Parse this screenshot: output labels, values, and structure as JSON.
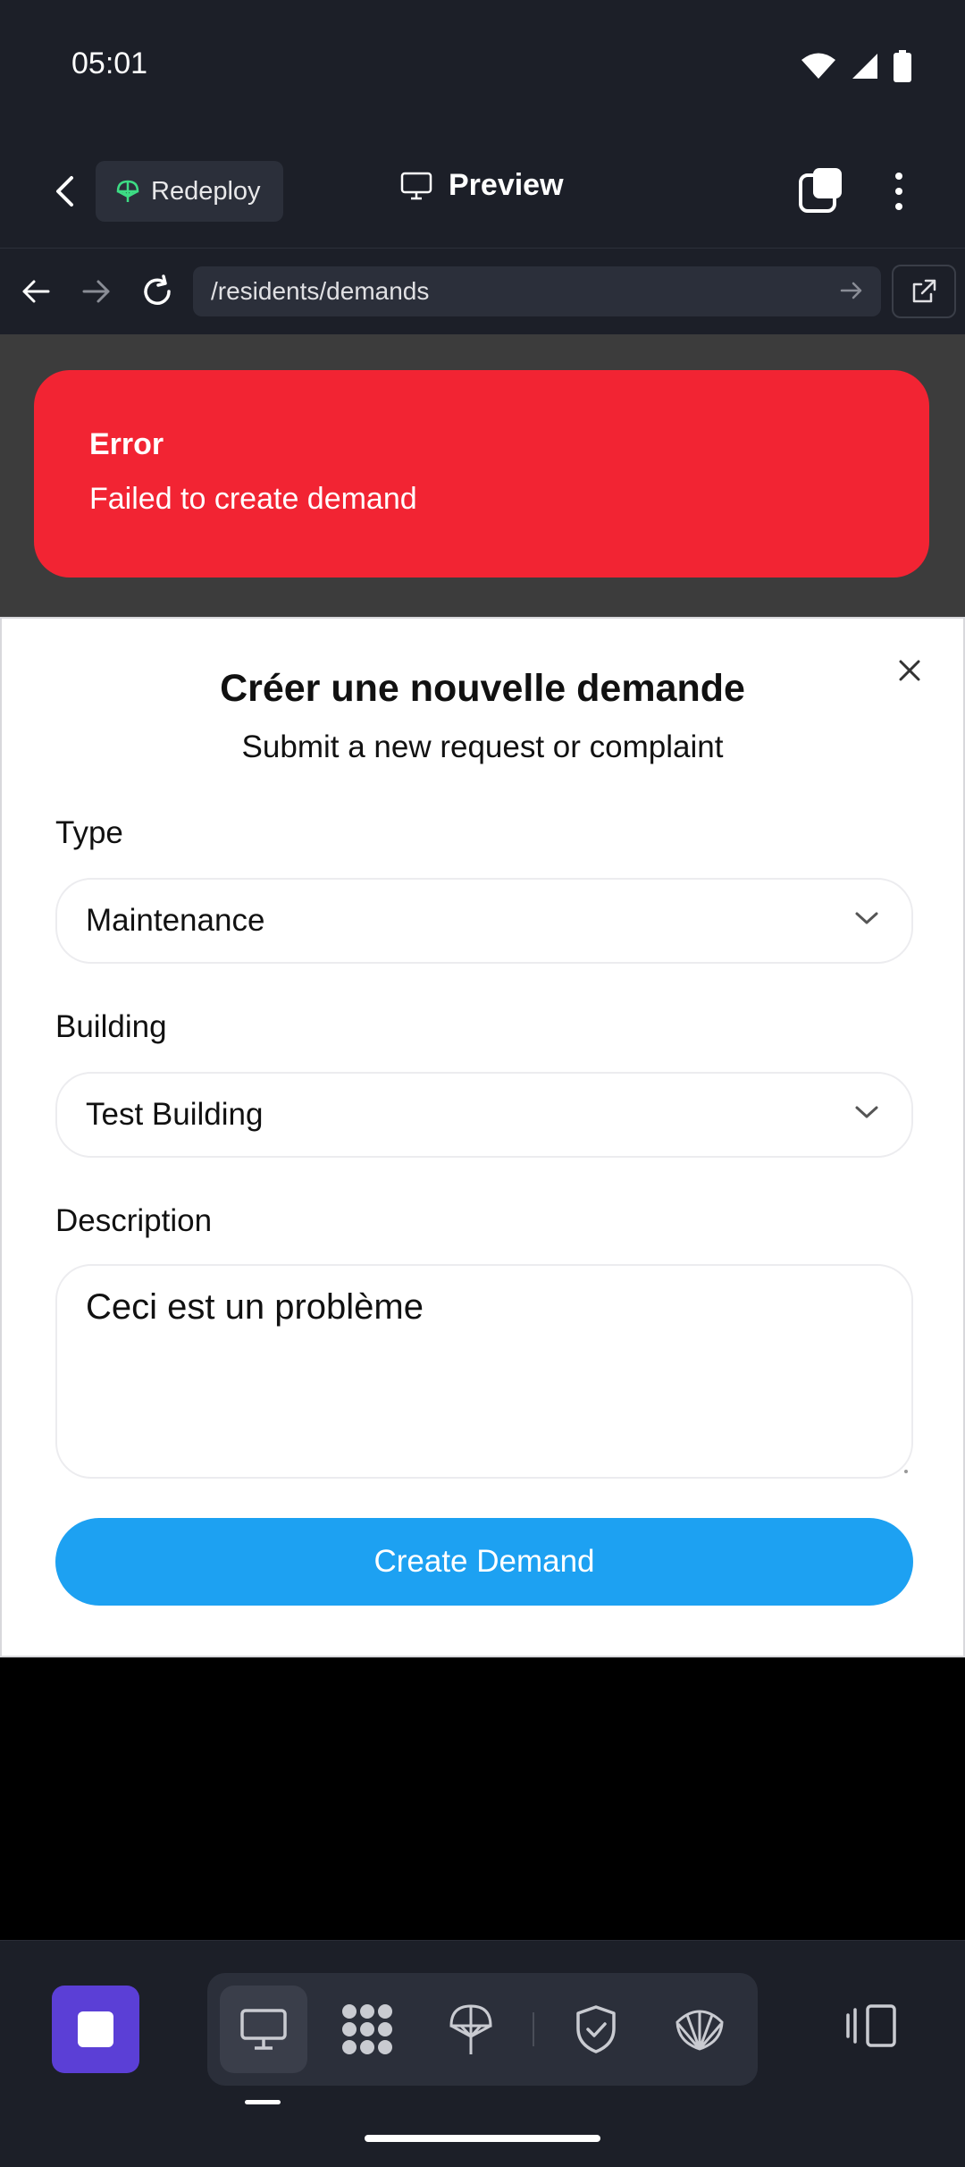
{
  "status_bar": {
    "time": "05:01"
  },
  "header": {
    "redeploy_label": "Redeploy",
    "preview_label": "Preview"
  },
  "browser": {
    "url": "/residents/demands"
  },
  "toast": {
    "title": "Error",
    "message": "Failed to create demand",
    "color": "#f22433"
  },
  "modal": {
    "title": "Créer une nouvelle demande",
    "subtitle": "Submit a new request or complaint",
    "type_label": "Type",
    "type_value": "Maintenance",
    "building_label": "Building",
    "building_value": "Test Building",
    "description_label": "Description",
    "description_value": "Ceci est un problème",
    "submit_label": "Create Demand",
    "accent_color": "#1da1f2"
  },
  "dock": {
    "tools": [
      "monitor-icon",
      "grid-dots-icon",
      "deploy-icon",
      "shield-check-icon",
      "shell-icon"
    ],
    "active_tool": "monitor-icon",
    "home_color": "#5b3fd6"
  }
}
